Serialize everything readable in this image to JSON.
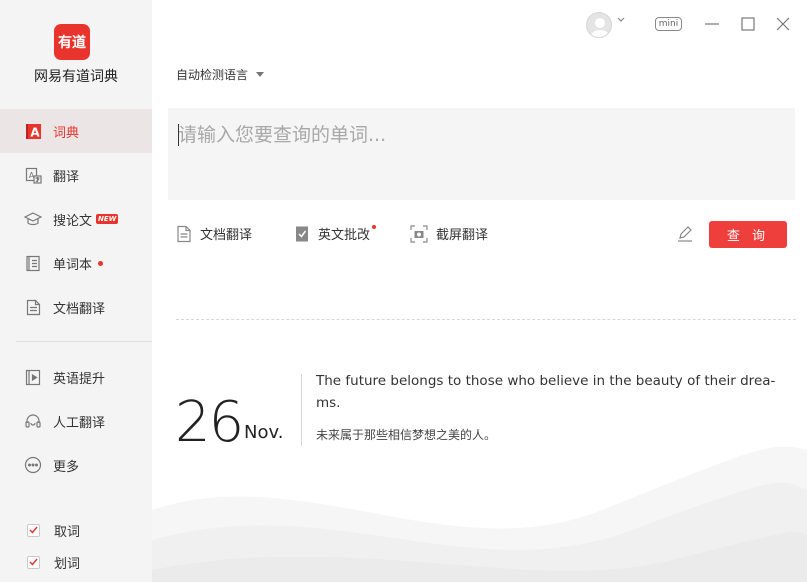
{
  "app": {
    "logo_text": "有道",
    "name": "网易有道词典"
  },
  "sidebar": {
    "items": [
      {
        "label": "词典",
        "icon": "dictionary-icon",
        "active": true
      },
      {
        "label": "翻译",
        "icon": "translate-icon"
      },
      {
        "label": "搜论文",
        "icon": "graduation-cap-icon",
        "badge": "NEW"
      },
      {
        "label": "单词本",
        "icon": "wordbook-icon",
        "dot": true
      },
      {
        "label": "文档翻译",
        "icon": "document-icon"
      },
      {
        "label": "英语提升",
        "icon": "play-video-icon"
      },
      {
        "label": "人工翻译",
        "icon": "headset-icon"
      },
      {
        "label": "更多",
        "icon": "more-icon"
      }
    ],
    "checks": [
      {
        "label": "取词",
        "checked": true
      },
      {
        "label": "划词",
        "checked": true
      }
    ]
  },
  "titlebar": {
    "mini_label": "mini"
  },
  "search": {
    "language": "自动检测语言",
    "placeholder": "请输入您要查询的单词..."
  },
  "tools": [
    {
      "label": "文档翻译",
      "icon": "document-icon"
    },
    {
      "label": "英文批改",
      "icon": "check-doc-icon",
      "dot": true
    },
    {
      "label": "截屏翻译",
      "icon": "screenshot-icon"
    }
  ],
  "query_button": "查 询",
  "daily": {
    "day": "26",
    "month": "Nov.",
    "quote_en": "The future belongs to those who believe in the beauty of their drea-ms.",
    "quote_cn": "未来属于那些相信梦想之美的人。"
  },
  "colors": {
    "accent": "#e8342d",
    "button": "#ee3f3c",
    "sidebar_bg": "#f4f4f4"
  }
}
